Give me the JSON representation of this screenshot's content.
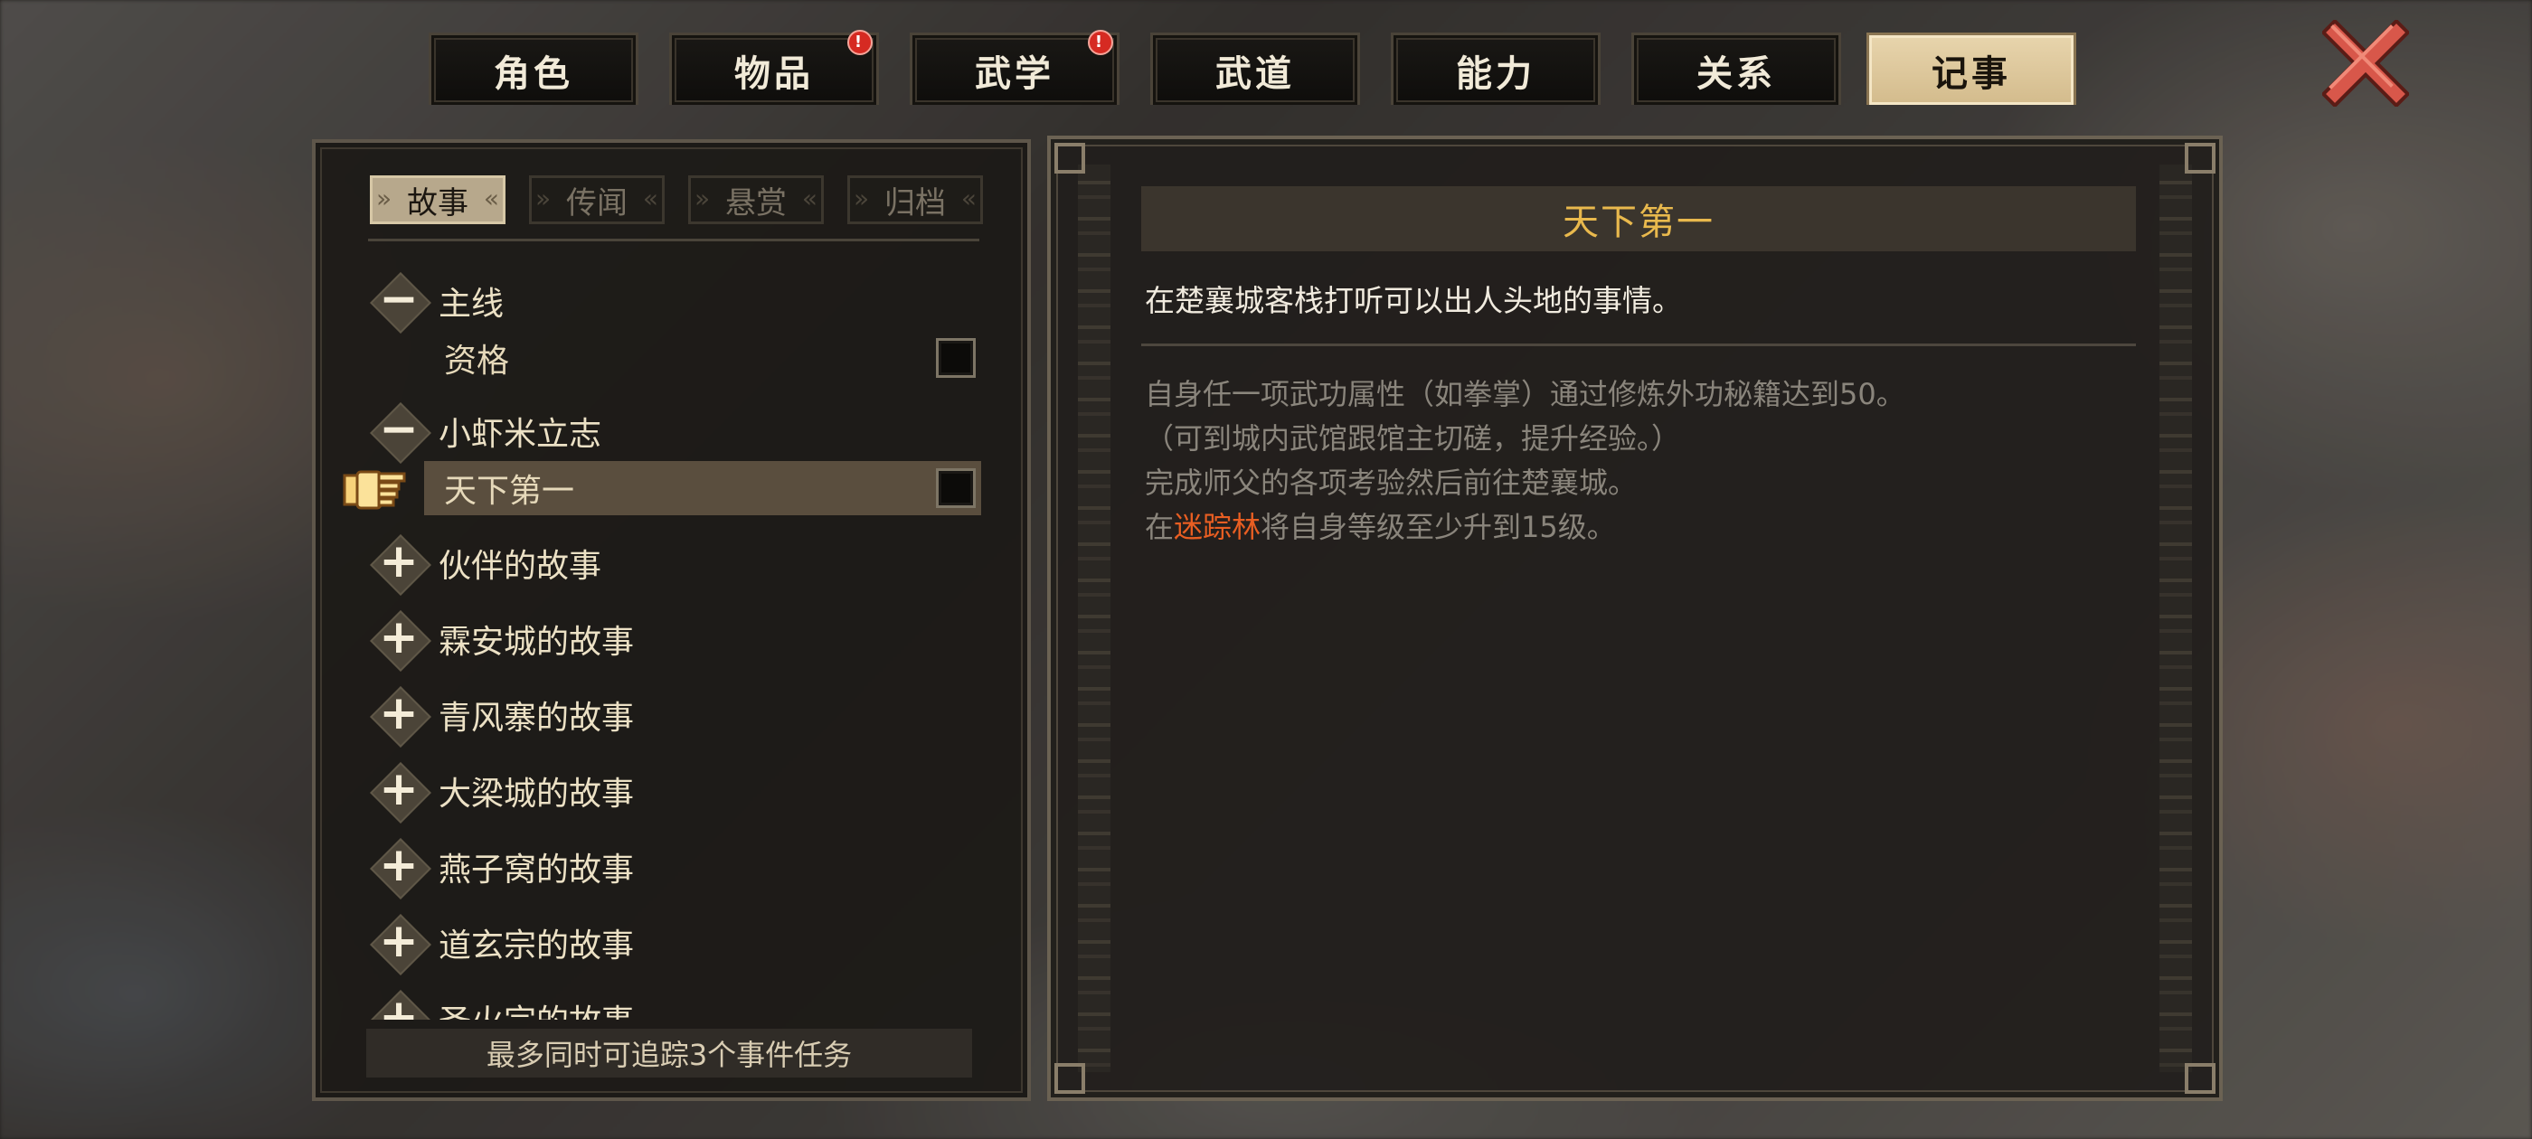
{
  "tabs": [
    {
      "label": "角色",
      "alert": false
    },
    {
      "label": "物品",
      "alert": true
    },
    {
      "label": "武学",
      "alert": true
    },
    {
      "label": "武道",
      "alert": false
    },
    {
      "label": "能力",
      "alert": false
    },
    {
      "label": "关系",
      "alert": false
    },
    {
      "label": "记事",
      "alert": false,
      "active": true
    }
  ],
  "alert_mark": "!",
  "subtabs": [
    "故事",
    "传闻",
    "悬赏",
    "归档"
  ],
  "quest_list": {
    "cat_main": "主线",
    "item_zige": "资格",
    "cat_xiaoxiami": "小虾米立志",
    "item_tianxia": "天下第一",
    "cat_huoban": "伙伴的故事",
    "cat_linan": "霖安城的故事",
    "cat_qingfeng": "青风寨的故事",
    "cat_daliang": "大梁城的故事",
    "cat_yanziwo": "燕子窝的故事",
    "cat_daoxuan": "道玄宗的故事",
    "cat_shenghuo": "圣火宗的故事",
    "expand_glyph": "+",
    "collapse_glyph": "−"
  },
  "footer_note": "最多同时可追踪3个事件任务",
  "detail": {
    "title": "天下第一",
    "description": "在楚襄城客栈打听可以出人头地的事情。",
    "cond1": "自身任一项武功属性（如拳掌）通过修炼外功秘籍达到50。",
    "cond2": "（可到城内武馆跟馆主切磋，提升经验。）",
    "cond3": "完成师父的各项考验然后前往楚襄城。",
    "cond4_prefix": "在",
    "cond4_place": "迷踪林",
    "cond4_suffix": "将自身等级至少升到15级。"
  },
  "colors": {
    "active_tab": "#d3bb8c",
    "title_gold": "#e9b94d",
    "highlight_orange": "#e85e22",
    "alert_red": "#d62a22"
  }
}
